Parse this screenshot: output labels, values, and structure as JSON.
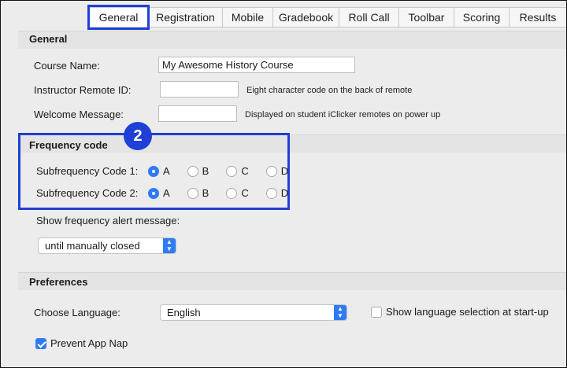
{
  "tabs": [
    {
      "label": "General",
      "active": true
    },
    {
      "label": "Registration",
      "active": false
    },
    {
      "label": "Mobile",
      "active": false
    },
    {
      "label": "Gradebook",
      "active": false
    },
    {
      "label": "Roll Call",
      "active": false
    },
    {
      "label": "Toolbar",
      "active": false
    },
    {
      "label": "Scoring",
      "active": false
    },
    {
      "label": "Results",
      "active": false
    }
  ],
  "general": {
    "title": "General",
    "course_name_label": "Course Name:",
    "course_name_value": "My Awesome History Course",
    "remote_id_label": "Instructor Remote ID:",
    "remote_id_value": "",
    "remote_id_hint": "Eight character code on the back of remote",
    "welcome_label": "Welcome Message:",
    "welcome_value": "",
    "welcome_hint": "Displayed on student iClicker remotes on power up"
  },
  "frequency": {
    "title": "Frequency code",
    "badge": "2",
    "code1_label": "Subfrequency Code 1:",
    "code2_label": "Subfrequency Code 2:",
    "options": [
      "A",
      "B",
      "C",
      "D"
    ],
    "code1_selected": "A",
    "code2_selected": "A",
    "alert_label": "Show frequency alert message:",
    "alert_value": "until manually closed"
  },
  "preferences": {
    "title": "Preferences",
    "language_label": "Choose Language:",
    "language_value": "English",
    "show_language_label": "Show language selection at start-up",
    "show_language_checked": false,
    "app_nap_label": "Prevent App Nap",
    "app_nap_checked": true
  },
  "colors": {
    "accent": "#2f7bf5",
    "annotation": "#1f3fd6"
  }
}
